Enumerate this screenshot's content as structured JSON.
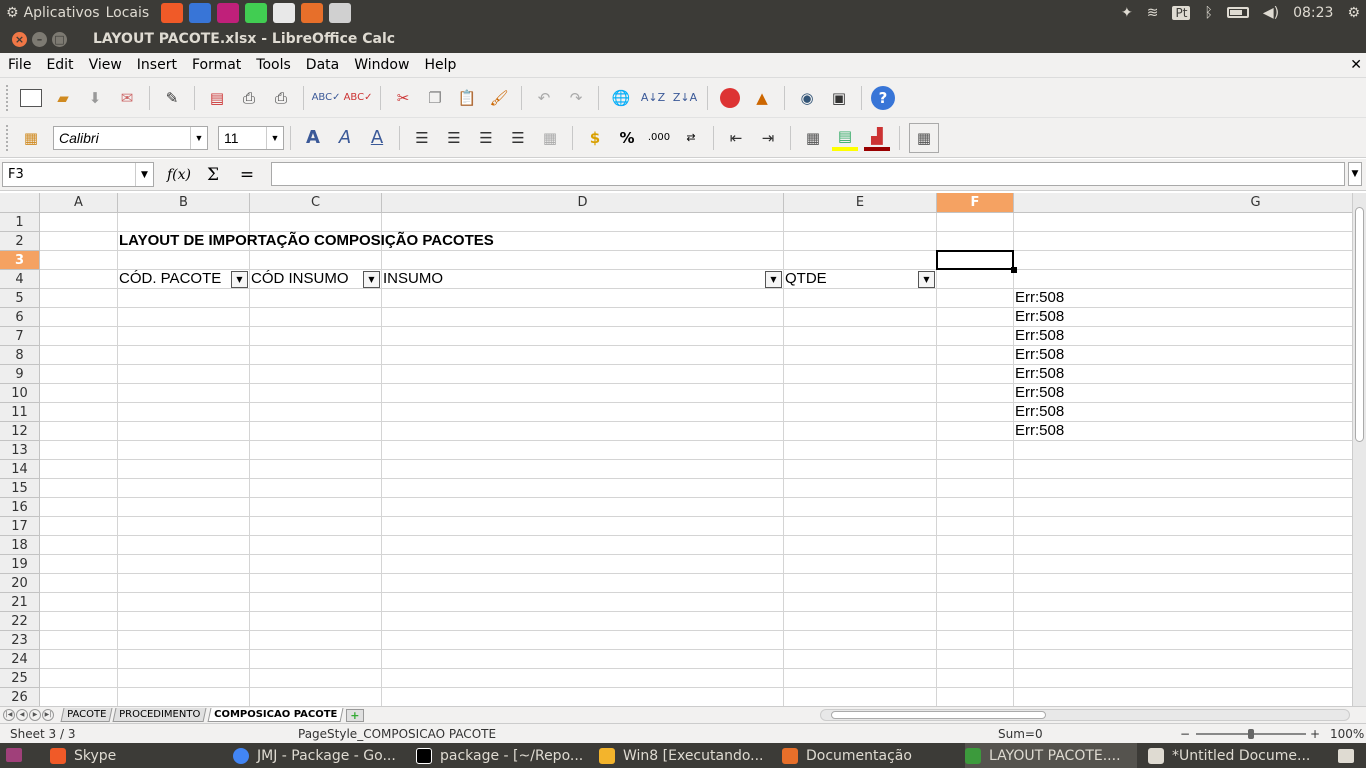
{
  "topbar": {
    "menu_apps": "Aplicativos",
    "menu_places": "Locais",
    "lang": "Pt",
    "time": "08:23"
  },
  "window": {
    "title": "LAYOUT PACOTE.xlsx - LibreOffice Calc"
  },
  "menubar": {
    "items": [
      "File",
      "Edit",
      "View",
      "Insert",
      "Format",
      "Tools",
      "Data",
      "Window",
      "Help"
    ]
  },
  "toolbar2": {
    "font_name": "Calibri",
    "font_size": "11",
    "percent": "%",
    "decimal": ".000"
  },
  "formulabar": {
    "cell_ref": "F3",
    "formula": "",
    "fx_symbol": "f(x)",
    "sum_symbol": "Σ",
    "equals_symbol": "="
  },
  "sheet": {
    "columns": [
      "A",
      "B",
      "C",
      "D",
      "E",
      "F",
      "G"
    ],
    "active_column": "F",
    "rows": [
      "1",
      "2",
      "3",
      "4",
      "5",
      "6",
      "7",
      "8",
      "9",
      "10",
      "11",
      "12",
      "13",
      "14",
      "15",
      "16",
      "17",
      "18",
      "19",
      "20",
      "21",
      "22",
      "23",
      "24",
      "25",
      "26"
    ],
    "active_row": "3",
    "title": "LAYOUT DE IMPORTAÇÃO COMPOSIÇÃO PACOTES",
    "headers": {
      "b": "CÓD. PACOTE",
      "c": "CÓD INSUMO",
      "d": "INSUMO",
      "e": "QTDE"
    },
    "g_values": [
      "Err:508",
      "Err:508",
      "Err:508",
      "Err:508",
      "Err:508",
      "Err:508",
      "Err:508",
      "Err:508"
    ]
  },
  "tabs": {
    "items": [
      "PACOTE",
      "PROCEDIMENTO",
      "COMPOSICAO PACOTE"
    ],
    "active": "COMPOSICAO PACOTE"
  },
  "status": {
    "sheet": "Sheet 3 / 3",
    "pagestyle": "PageStyle_COMPOSICAO PACOTE",
    "sum": "Sum=0",
    "zoom": "100%",
    "zoom_level": 1.0
  },
  "taskbar": {
    "items": [
      "Skype",
      "JMJ - Package - Go...",
      "package - [~/Repo...",
      "Win8 [Executando...",
      "Documentação",
      "LAYOUT PACOTE....",
      "*Untitled Docume..."
    ],
    "active": "LAYOUT PACOTE...."
  },
  "colors": {
    "system_bar": "#3c3b37",
    "accent_orange": "#f5a262",
    "close_button": "#f07746"
  }
}
